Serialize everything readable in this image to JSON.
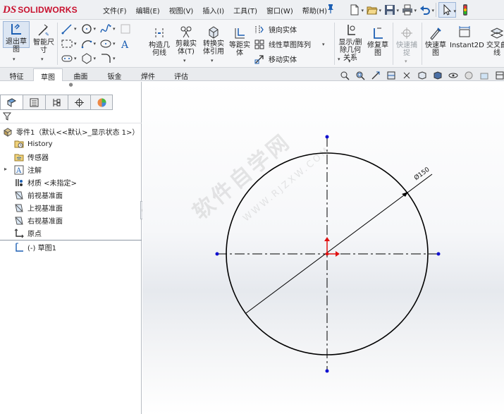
{
  "app": {
    "logo_mark": "DS",
    "brand": "SOLIDWORKS"
  },
  "menu": [
    "文件(F)",
    "编辑(E)",
    "视图(V)",
    "插入(I)",
    "工具(T)",
    "窗口(W)",
    "帮助(H)"
  ],
  "quickbar": [
    "new-document-icon",
    "open-icon",
    "save-icon",
    "print-icon",
    "undo-icon",
    "select-arrow-icon",
    "traffic-light-icon"
  ],
  "ribbon": {
    "exit_sketch": "退出草图",
    "smart_dimension": "智能尺寸",
    "construction_geometry": "构造几何线",
    "trim_entities": "剪裁实体(T)",
    "convert_entities": "转换实体引用",
    "offset_entities": "等距实体",
    "mirror_entities": "镜向实体",
    "linear_pattern": "线性草图阵列",
    "move_entities": "移动实体",
    "display_delete_relations": "显示/删除几何关系",
    "repair_sketch": "修复草图",
    "quick_snaps": "快速捕捉",
    "rapid_sketch": "快速草图",
    "instant2d": "Instant2D",
    "intersection_curve": "交叉曲线"
  },
  "tabs": [
    {
      "label": "特征"
    },
    {
      "label": "草图"
    },
    {
      "label": "曲面"
    },
    {
      "label": "钣金"
    },
    {
      "label": "焊件"
    },
    {
      "label": "评估"
    }
  ],
  "active_tab": "草图",
  "feature_tree": {
    "part_root": "零件1（默认<<默认>_显示状态 1>）",
    "items": [
      {
        "label": "History",
        "icon": "history-folder-icon"
      },
      {
        "label": "传感器",
        "icon": "sensors-icon"
      },
      {
        "label": "注解",
        "icon": "annotations-icon"
      },
      {
        "label": "材质 <未指定>",
        "icon": "material-icon"
      },
      {
        "label": "前视基准面",
        "icon": "plane-icon"
      },
      {
        "label": "上视基准面",
        "icon": "plane-icon"
      },
      {
        "label": "右视基准面",
        "icon": "plane-icon"
      },
      {
        "label": "原点",
        "icon": "origin-icon"
      },
      {
        "label": "(-) 草图1",
        "icon": "sketch-icon"
      }
    ]
  },
  "sketch": {
    "shape": "circle",
    "diameter_label": "Ø150",
    "diameter_value": 150,
    "line_color": "#000000",
    "centerline_color": "#000000",
    "point_color": "#1010d0",
    "origin_color": "#e01010"
  },
  "watermark": {
    "text": "软件自学网",
    "url": "WWW.RJZXW.COM"
  }
}
